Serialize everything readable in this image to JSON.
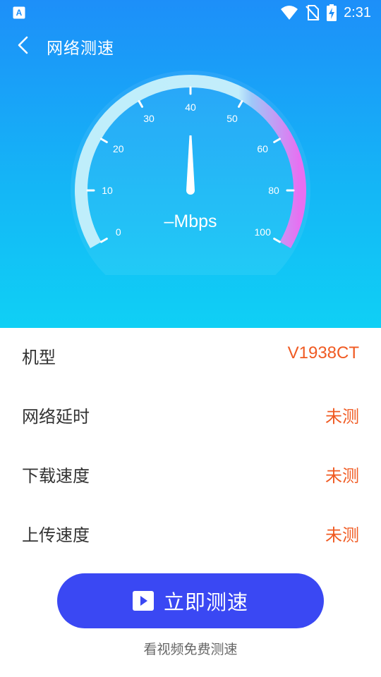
{
  "status_bar": {
    "time": "2:31",
    "icons": [
      "app-a-icon",
      "wifi-icon",
      "no-sim-icon",
      "battery-charging-icon"
    ]
  },
  "header": {
    "title": "网络测速",
    "back_icon": "chevron-left-icon"
  },
  "gauge": {
    "readout": "–Mbps",
    "value": 40,
    "ticks": [
      {
        "value": 0,
        "label": "0"
      },
      {
        "value": 10,
        "label": "10"
      },
      {
        "value": 20,
        "label": "20"
      },
      {
        "value": 30,
        "label": "30"
      },
      {
        "value": 40,
        "label": "40"
      },
      {
        "value": 50,
        "label": "50"
      },
      {
        "value": 60,
        "label": "60"
      },
      {
        "value": 80,
        "label": "80"
      },
      {
        "value": 100,
        "label": "100"
      }
    ],
    "colors": {
      "arc_start": "#bfeefb",
      "arc_end": "#e86ff1"
    }
  },
  "info": {
    "rows": [
      {
        "label": "机型",
        "value": "V1938CT"
      },
      {
        "label": "网络延时",
        "value": "未测"
      },
      {
        "label": "下载速度",
        "value": "未测"
      },
      {
        "label": "上传速度",
        "value": "未测"
      }
    ]
  },
  "actions": {
    "start_label": "立即测速",
    "start_icon": "play-icon",
    "footnote": "看视频免费测速"
  },
  "colors": {
    "header_gradient_top": "#1d8ff9",
    "header_gradient_bottom": "#0fd0f5",
    "value_text": "#f05a22",
    "button": "#3a48f3"
  }
}
